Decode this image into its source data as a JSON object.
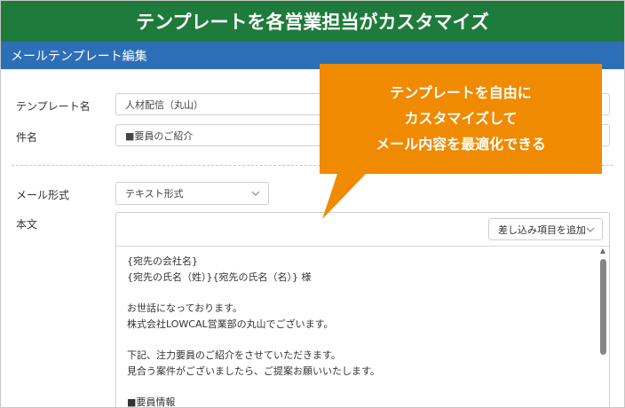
{
  "banner": {
    "title": "テンプレートを各営業担当がカスタマイズ"
  },
  "section": {
    "title": "メールテンプレート編集"
  },
  "form": {
    "template_name_label": "テンプレート名",
    "template_name_value": "人材配信（丸山）",
    "subject_label": "件名",
    "subject_value": "■要員のご紹介",
    "mail_format_label": "メール形式",
    "mail_format_value": "テキスト形式",
    "body_label": "本文",
    "insert_field_label": "差し込み項目を追加"
  },
  "body_lines": [
    "{宛先の会社名}",
    "{宛先の氏名（姓）}{宛先の氏名（名）} 様",
    "",
    "お世話になっております。",
    "株式会社LOWCAL営業部の丸山でございます。",
    "",
    "下記、注力要員のご紹介をさせていただきます。",
    "見合う案件がございましたら、ご提案お願いいたします。",
    "",
    "■要員情報"
  ],
  "callout": {
    "line1": "テンプレートを自由に",
    "line2": "カスタマイズして",
    "line3": "メール内容を最適化できる"
  },
  "colors": {
    "banner": "#1f7b3c",
    "section_bar": "#2d6fb7",
    "callout": "#f08a00"
  }
}
